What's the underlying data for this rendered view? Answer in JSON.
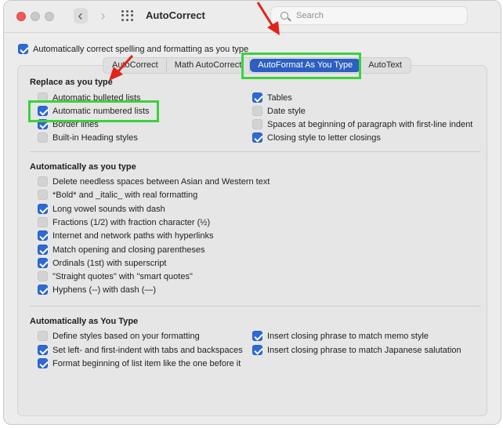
{
  "window": {
    "title": "AutoCorrect",
    "search_placeholder": "Search"
  },
  "top_option": {
    "label": "Automatically correct spelling and formatting as you type",
    "checked": true
  },
  "tabs": [
    {
      "label": "AutoCorrect",
      "active": false
    },
    {
      "label": "Math AutoCorrect",
      "active": false
    },
    {
      "label": "AutoFormat As You Type",
      "active": true
    },
    {
      "label": "AutoText",
      "active": false
    }
  ],
  "section1": {
    "title": "Replace as you type",
    "left": [
      {
        "label": "Automatic bulleted lists",
        "checked": false
      },
      {
        "label": "Automatic numbered lists",
        "checked": true
      },
      {
        "label": "Border lines",
        "checked": true
      },
      {
        "label": "Built-in Heading styles",
        "checked": false
      }
    ],
    "right": [
      {
        "label": "Tables",
        "checked": true
      },
      {
        "label": "Date style",
        "checked": false
      },
      {
        "label": "Spaces at beginning of paragraph with first-line indent",
        "checked": false
      },
      {
        "label": "Closing style to letter closings",
        "checked": true
      }
    ]
  },
  "section2": {
    "title": "Automatically as you type",
    "items": [
      {
        "label": "Delete needless spaces between Asian and Western text",
        "checked": false
      },
      {
        "label": "*Bold* and _italic_ with real formatting",
        "checked": false
      },
      {
        "label": "Long vowel sounds with dash",
        "checked": true
      },
      {
        "label": "Fractions (1/2) with fraction character (½)",
        "checked": false
      },
      {
        "label": "Internet and network paths with hyperlinks",
        "checked": true
      },
      {
        "label": "Match opening and closing parentheses",
        "checked": true
      },
      {
        "label": "Ordinals (1st) with superscript",
        "checked": true
      },
      {
        "label": "\"Straight quotes\" with \"smart quotes\"",
        "checked": false
      },
      {
        "label": "Hyphens (--) with dash (—)",
        "checked": true
      }
    ]
  },
  "section3": {
    "title": "Automatically as You Type",
    "left": [
      {
        "label": "Define styles based on your formatting",
        "checked": false
      },
      {
        "label": "Set left- and first-indent with tabs and backspaces",
        "checked": true
      },
      {
        "label": "Format beginning of list item like the one before it",
        "checked": true
      }
    ],
    "right": [
      {
        "label": "Insert closing phrase to match memo style",
        "checked": true
      },
      {
        "label": "Insert closing phrase to match Japanese salutation",
        "checked": true
      }
    ]
  },
  "colors": {
    "accent": "#2d6ad4",
    "highlight": "#3ad23a",
    "annotation_arrow": "#e0231c"
  }
}
